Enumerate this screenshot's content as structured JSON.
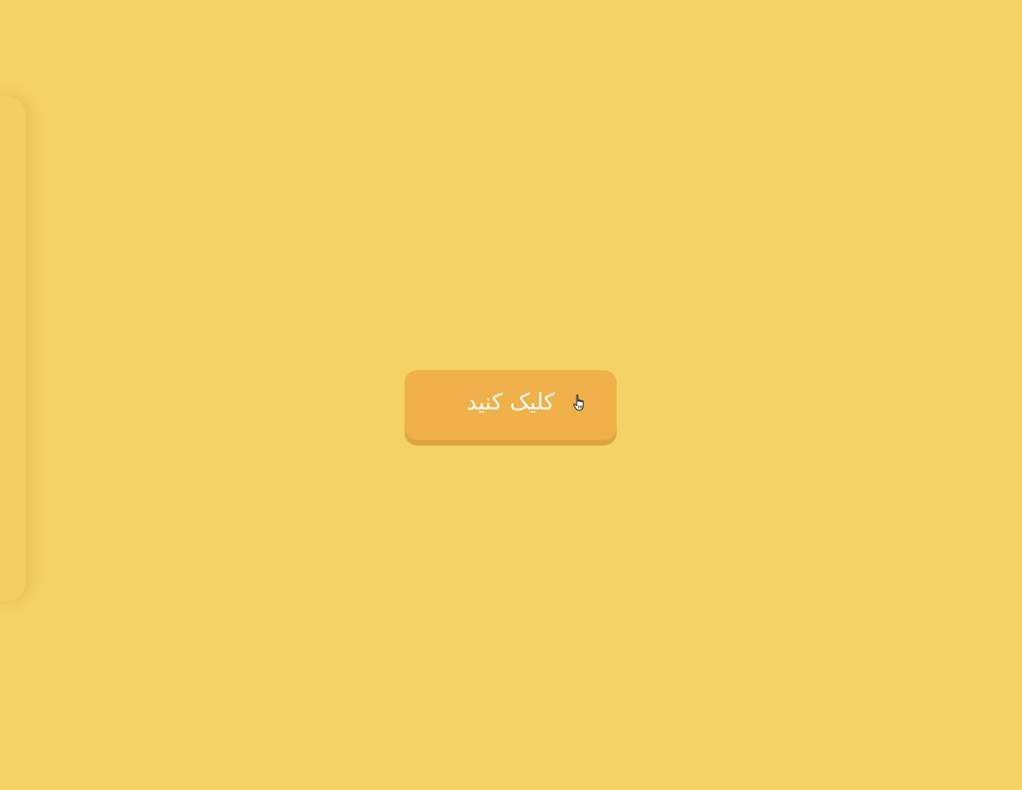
{
  "page": {
    "background_color": "#f5d266"
  },
  "button": {
    "label": "کلیک کنید",
    "color": "#f0b04a",
    "text_color": "#ffffff"
  },
  "cursor": {
    "icon": "hand-pointer-icon"
  }
}
